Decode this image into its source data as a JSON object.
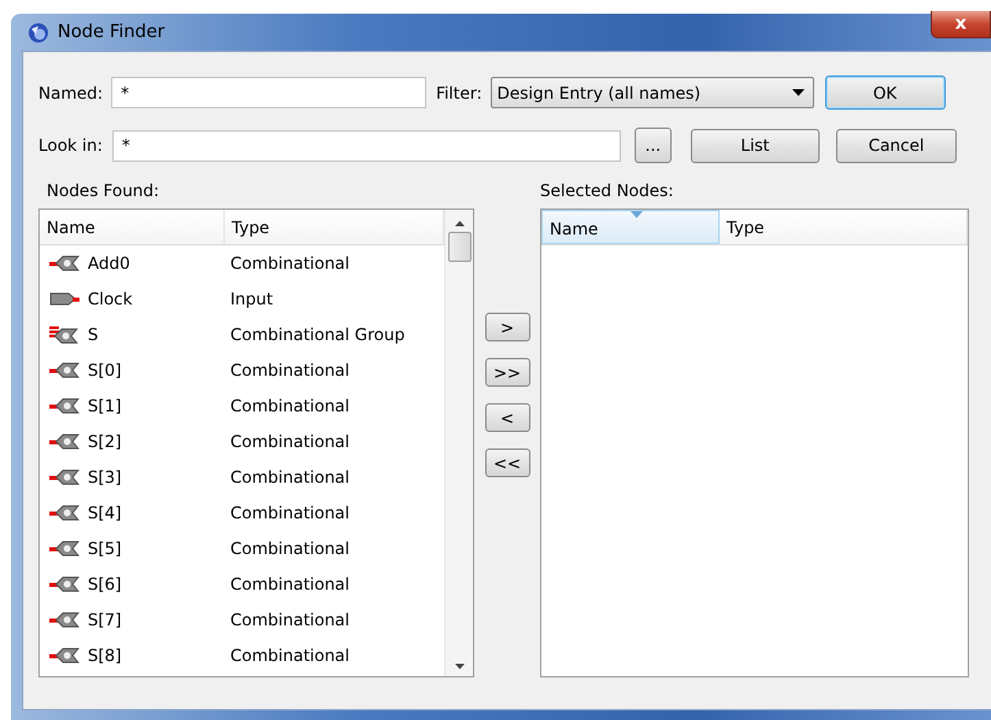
{
  "window": {
    "title": "Node Finder",
    "close": "x"
  },
  "named": {
    "label": "Named:",
    "value": "*"
  },
  "filter": {
    "label": "Filter:",
    "value": "Design Entry (all names)"
  },
  "look_in": {
    "label": "Look in:",
    "value": "*",
    "browse": "..."
  },
  "buttons": {
    "ok": "OK",
    "list": "List",
    "cancel": "Cancel"
  },
  "nodes_found": {
    "label": "Nodes Found:",
    "columns": [
      "Name",
      "Type"
    ],
    "rows": [
      {
        "kind": "combinational",
        "name": "Add0",
        "type": "Combinational"
      },
      {
        "kind": "input",
        "name": "Clock",
        "type": "Input"
      },
      {
        "kind": "group",
        "name": "S",
        "type": "Combinational Group"
      },
      {
        "kind": "combinational",
        "name": "S[0]",
        "type": "Combinational"
      },
      {
        "kind": "combinational",
        "name": "S[1]",
        "type": "Combinational"
      },
      {
        "kind": "combinational",
        "name": "S[2]",
        "type": "Combinational"
      },
      {
        "kind": "combinational",
        "name": "S[3]",
        "type": "Combinational"
      },
      {
        "kind": "combinational",
        "name": "S[4]",
        "type": "Combinational"
      },
      {
        "kind": "combinational",
        "name": "S[5]",
        "type": "Combinational"
      },
      {
        "kind": "combinational",
        "name": "S[6]",
        "type": "Combinational"
      },
      {
        "kind": "combinational",
        "name": "S[7]",
        "type": "Combinational"
      },
      {
        "kind": "combinational",
        "name": "S[8]",
        "type": "Combinational"
      }
    ]
  },
  "transfer_buttons": [
    ">",
    ">>",
    "<",
    "<<"
  ],
  "selected_nodes": {
    "label": "Selected Nodes:",
    "columns": [
      {
        "label": "Name",
        "sorted": true
      },
      {
        "label": "Type",
        "sorted": false
      }
    ]
  }
}
